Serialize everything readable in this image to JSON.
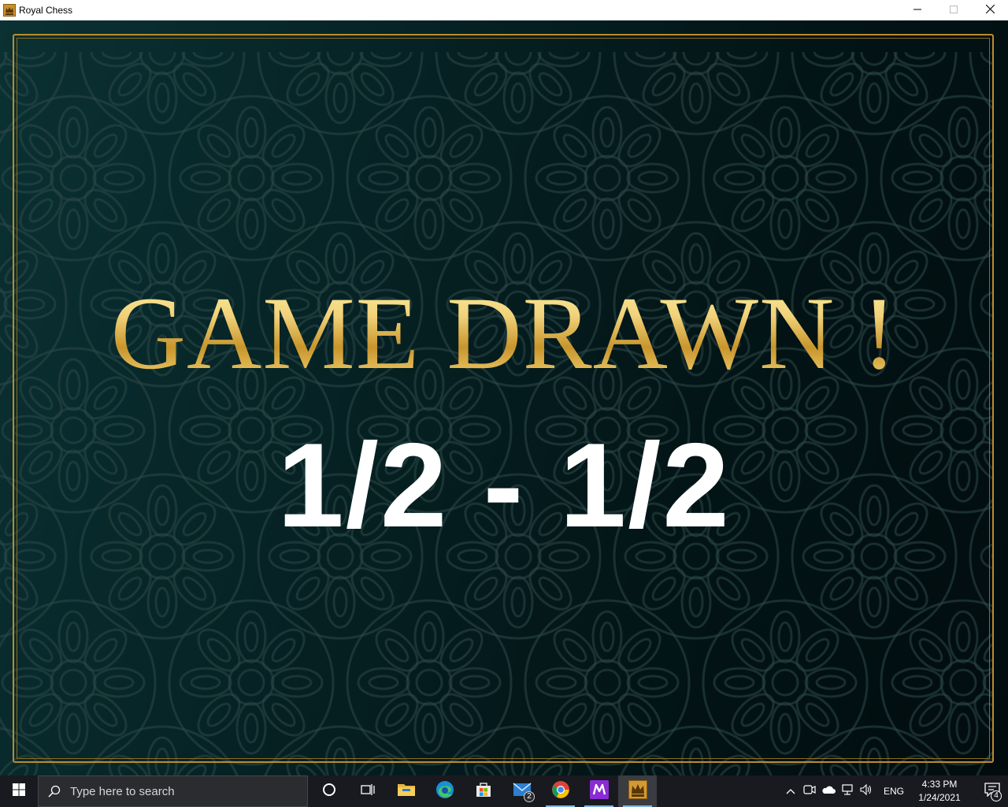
{
  "window": {
    "title": "Royal Chess",
    "app_icon": "chess-crown-icon",
    "controls": [
      "minimize-icon",
      "maximize-icon",
      "close-icon"
    ]
  },
  "game": {
    "headline": "GAME DRAWN !",
    "score": "1/2 - 1/2",
    "colors": {
      "background": "#062224",
      "frame": "#b88d2e",
      "headline_gold": "#e9c563",
      "score_text": "#ffffff"
    }
  },
  "taskbar": {
    "search_placeholder": "Type here to search",
    "pinned": [
      {
        "icon": "cortana-icon"
      },
      {
        "icon": "task-view-icon"
      },
      {
        "icon": "file-explorer-icon"
      },
      {
        "icon": "edge-icon"
      },
      {
        "icon": "store-icon"
      },
      {
        "icon": "mail-icon",
        "badge": "2"
      },
      {
        "icon": "chrome-icon"
      },
      {
        "icon": "m-app-icon"
      },
      {
        "icon": "royal-chess-icon"
      }
    ],
    "tray": {
      "icons": [
        "chevron-up-icon",
        "meet-now-icon",
        "onedrive-icon",
        "network-icon",
        "volume-icon"
      ],
      "language": "ENG",
      "time": "4:33 PM",
      "date": "1/24/2021",
      "notification_count": "4"
    }
  }
}
